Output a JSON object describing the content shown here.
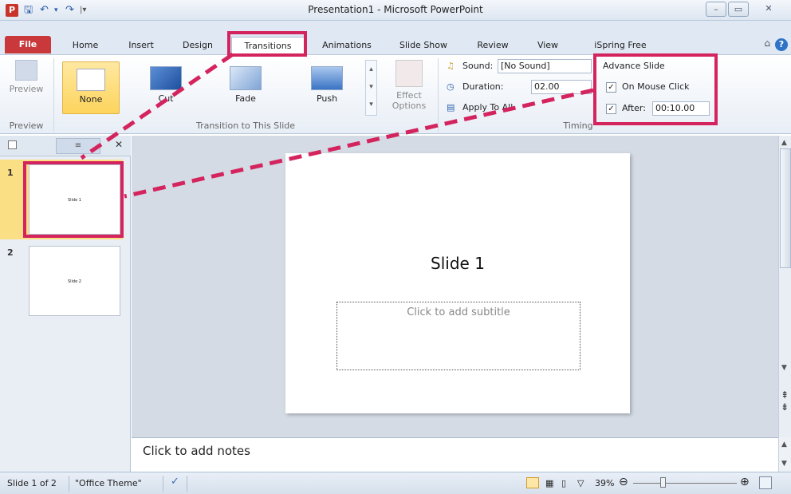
{
  "window": {
    "title": "Presentation1 - Microsoft PowerPoint",
    "app_icon": "P",
    "min": "–",
    "max": "▭",
    "close": "✕"
  },
  "qat": {
    "save": "🖫",
    "undo": "↶",
    "dropdown": "▾",
    "redo": "↷",
    "customize": "|▾"
  },
  "tabs": {
    "file": "File",
    "home": "Home",
    "insert": "Insert",
    "design": "Design",
    "transitions": "Transitions",
    "animations": "Animations",
    "slideshow": "Slide Show",
    "review": "Review",
    "view": "View",
    "ispring": "iSpring Free",
    "help": "?",
    "minimize_ribbon": "⌂"
  },
  "ribbon": {
    "preview_btn": "Preview",
    "preview_group": "Preview",
    "none_btn": "None",
    "cut_btn": "Cut",
    "fade_btn": "Fade",
    "push_btn": "Push",
    "effect_options": "Effect Options",
    "transition_group": "Transition to This Slide",
    "sound_label": "Sound:",
    "sound_value": "[No Sound]",
    "duration_label": "Duration:",
    "duration_value": "02.00",
    "apply_to_all": "Apply To All",
    "timing_group": "Timing",
    "advance_title": "Advance Slide",
    "on_mouse_click": "On Mouse Click",
    "after_label": "After:",
    "after_value": "00:10.00",
    "check": "✓",
    "spin": "⬍"
  },
  "panel": {
    "close": "✕",
    "slides": [
      {
        "num": "1",
        "label": "Slide 1"
      },
      {
        "num": "2",
        "label": "Slide 2"
      }
    ]
  },
  "slide": {
    "title": "Slide 1",
    "subtitle_placeholder": "Click to add subtitle"
  },
  "notes": {
    "placeholder": "Click to add notes"
  },
  "status": {
    "slide_of": "Slide 1 of 2",
    "theme": "\"Office Theme\"",
    "zoom": "39%",
    "zoom_out": "⊖",
    "zoom_in": "⊕"
  },
  "colors": {
    "highlight": "#d4245e",
    "file_tab": "#c9383a",
    "selected": "#fdd45c"
  }
}
